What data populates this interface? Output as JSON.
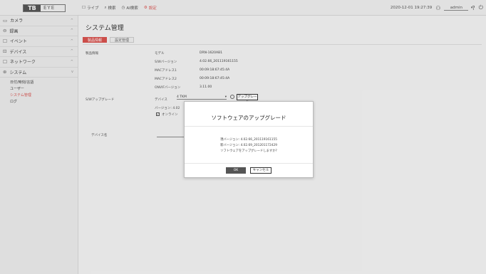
{
  "logo": {
    "part1": "TB",
    "part2": "EYE"
  },
  "topnav": [
    {
      "icon": "monitor-icon",
      "glyph": "☐",
      "label": "ライブ"
    },
    {
      "icon": "search-icon",
      "glyph": "⌕",
      "label": "検索"
    },
    {
      "icon": "clock-icon",
      "glyph": "◷",
      "label": "AI検索"
    },
    {
      "icon": "gear-icon",
      "glyph": "⚙",
      "label": "設定"
    }
  ],
  "topright": {
    "datetime": "2020-12-01 19:27:39",
    "user": "admin",
    "help": "?",
    "power": "⏻"
  },
  "sidebar": {
    "items": [
      {
        "icon": "camera-icon",
        "glyph": "▭",
        "label": "カメラ",
        "chev": "^"
      },
      {
        "icon": "record-icon",
        "glyph": "⊖",
        "label": "録画",
        "chev": "^"
      },
      {
        "icon": "event-icon",
        "glyph": "☐",
        "label": "イベント",
        "chev": "^"
      },
      {
        "icon": "device-icon",
        "glyph": "⊡",
        "label": "デバイス",
        "chev": "^"
      },
      {
        "icon": "network-icon",
        "glyph": "☐",
        "label": "ネットワーク",
        "chev": "^"
      },
      {
        "icon": "system-icon",
        "glyph": "⊛",
        "label": "システム",
        "chev": "v"
      }
    ],
    "submenu": [
      "日付/時刻/言語",
      "ユーザー",
      "システム管理",
      "ログ"
    ]
  },
  "main": {
    "title": "システム管理",
    "tabs": [
      "製品情報",
      "設定管理"
    ]
  },
  "product_info": {
    "section": "製品情報",
    "fields": [
      {
        "label": "モデル",
        "value": "DRN-1620AB1"
      },
      {
        "label": "S/Wバージョン",
        "value": "4.02.66_201119161155"
      },
      {
        "label": "MACアドレス1",
        "value": "00:09:18:67:45:4A"
      },
      {
        "label": "MACアドレス2",
        "value": "00:09:18:67:45:4A"
      },
      {
        "label": "ONVIFバージョン",
        "value": "3.11.00"
      }
    ]
  },
  "sw_upgrade": {
    "section": "S/Wアップグレード",
    "device_label": "デバイス",
    "device_value": "4 TKM",
    "upgrade_button": "アップグレード",
    "version_label": "バージョン: 4.02",
    "online_label": "オンライン"
  },
  "device_name": {
    "label": "デバイス名"
  },
  "dialog": {
    "title": "ソフトウェアのアップグレード",
    "current_version": "現バージョン: 4.02.66_201119161155",
    "new_version": "新バージョン: 4.02.69_201201172429",
    "question": "ソフトウェアをアップグレードしますか?",
    "ok": "OK",
    "cancel": "キャンセル"
  }
}
